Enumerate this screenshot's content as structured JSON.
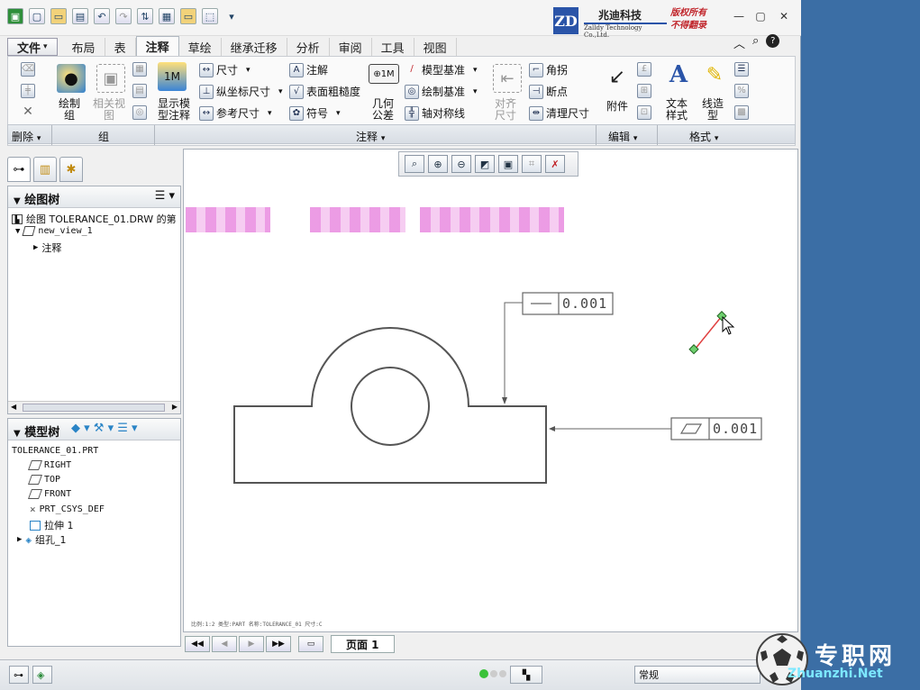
{
  "branding": {
    "company_cn": "兆迪科技",
    "company_en": "Zalldy Technology Co.,Ltd.",
    "logo_text": "ZD",
    "copyright_1": "版权所有",
    "copyright_2": "不得翻录"
  },
  "tabs": [
    {
      "label": "文件",
      "dropdown": "▾"
    },
    {
      "label": "布局"
    },
    {
      "label": "表"
    },
    {
      "label": "注释",
      "active": true
    },
    {
      "label": "草绘"
    },
    {
      "label": "继承迁移"
    },
    {
      "label": "分析"
    },
    {
      "label": "审阅"
    },
    {
      "label": "工具"
    },
    {
      "label": "视图"
    }
  ],
  "ribbon": {
    "group_draw": {
      "label": "绘制\n组"
    },
    "group_related": {
      "label": "相关视\n图"
    },
    "show_model": {
      "label": "显示模\n型注释"
    },
    "dimension": {
      "label": "尺寸"
    },
    "ordinate": {
      "label": "纵坐标尺寸"
    },
    "ref_dim": {
      "label": "参考尺寸"
    },
    "note": {
      "label": "注解"
    },
    "surface": {
      "label": "表面粗糙度"
    },
    "symbol": {
      "label": "符号"
    },
    "gtol": {
      "label": "几何\n公差"
    },
    "model_datum": {
      "label": "模型基准"
    },
    "draw_datum": {
      "label": "绘制基准"
    },
    "axis_sym": {
      "label": "轴对称线"
    },
    "align_dim": {
      "label": "对齐\n尺寸"
    },
    "corner": {
      "label": "角拐"
    },
    "breakpt": {
      "label": "断点"
    },
    "cleanup": {
      "label": "清理尺寸"
    },
    "attach": {
      "label": "附件"
    },
    "text_style": {
      "label": "文本\n样式"
    },
    "line_style": {
      "label": "线造\n型"
    }
  },
  "groups": {
    "delete": "删除",
    "group": "组",
    "annotate": "注释",
    "edit": "编辑",
    "format": "格式"
  },
  "drawing_tree": {
    "title": "绘图树",
    "root": "绘图 TOLERANCE_01.DRW 的第",
    "view": "new_view_1",
    "notes": "注释"
  },
  "model_tree": {
    "title": "模型树",
    "items": [
      "TOLERANCE_01.PRT",
      "RIGHT",
      "TOP",
      "FRONT",
      "PRT_CSYS_DEF",
      "拉伸 1",
      "组孔_1"
    ]
  },
  "drawing": {
    "tol_top": "0.001",
    "tol_right": "0.001",
    "footer": "比例:1:2    类型:PART    名称:TOLERANCE_01    尺寸:C"
  },
  "pagebar": {
    "page_label": "页面 1"
  },
  "status": {
    "mode": "常规"
  },
  "watermark": {
    "cn": "专职网",
    "en": "Zhuanzhi.Net"
  }
}
